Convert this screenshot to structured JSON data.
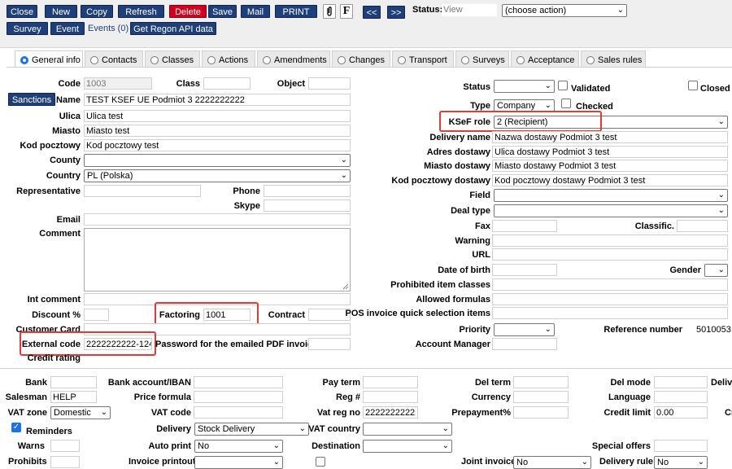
{
  "toolbar": {
    "row1": [
      "Close",
      "New",
      "Copy",
      "Refresh",
      "Delete",
      "Save",
      "Mail",
      "PRINT"
    ],
    "clip_icon": "paperclip-icon",
    "font_btn": "F",
    "prev": "<<",
    "next": ">>",
    "status_label": "Status:",
    "status_value": "View",
    "action_select": "(choose action)",
    "row2": [
      "Survey",
      "Event"
    ],
    "events_link": "Events (0)",
    "regon": "Get Regon API data"
  },
  "tabs": [
    "General info",
    "Contacts",
    "Classes",
    "Actions",
    "Amendments",
    "Changes",
    "Transport",
    "Surveys",
    "Acceptance",
    "Sales rules"
  ],
  "left": {
    "code_label": "Code",
    "code_value": "1003",
    "class_label": "Class",
    "object_label": "Object",
    "sanctions": "Sanctions",
    "name_label": "Name",
    "name_value": "TEST KSEF UE Podmiot 3 2222222222",
    "ulica_label": "Ulica",
    "ulica_value": "Ulica test",
    "miasto_label": "Miasto",
    "miasto_value": "Miasto test",
    "kod_label": "Kod pocztowy",
    "kod_value": "Kod pocztowy test",
    "county_label": "County",
    "country_label": "Country",
    "country_value": "PL (Polska)",
    "rep_label": "Representative",
    "phone_label": "Phone",
    "skype_label": "Skype",
    "email_label": "Email",
    "comment_label": "Comment",
    "intcomment_label": "Int comment",
    "discount_label": "Discount %",
    "factoring_label": "Factoring",
    "factoring_value": "1001",
    "contract_label": "Contract",
    "customercard_label": "Customer Card",
    "extcode_label": "External code",
    "extcode_value": "2222222222-124",
    "password_label": "Password for the emailed PDF invoice",
    "credit_label": "Credit rating"
  },
  "right": {
    "status_label": "Status",
    "validated_label": "Validated",
    "closed_label": "Closed",
    "type_label": "Type",
    "type_value": "Company",
    "checked_label": "Checked",
    "ksef_label": "KSeF role",
    "ksef_value": "2 (Recipient)",
    "delname_label": "Delivery name",
    "delname_value": "Nazwa dostawy Podmiot 3 test",
    "adres_label": "Adres dostawy",
    "adres_value": "Ulica dostawy Podmiot 3 test",
    "miastod_label": "Miasto dostawy",
    "miastod_value": "Miasto dostawy Podmiot 3 test",
    "kodd_label": "Kod pocztowy dostawy",
    "kodd_value": "Kod pocztowy dostawy Podmiot 3 test",
    "field_label": "Field",
    "dealtype_label": "Deal type",
    "fax_label": "Fax",
    "classific_label": "Classific.",
    "warning_label": "Warning",
    "url_label": "URL",
    "dob_label": "Date of birth",
    "gender_label": "Gender",
    "prohib_label": "Prohibited item classes",
    "allowed_label": "Allowed formulas",
    "pos_label": "POS invoice quick selection items",
    "priority_label": "Priority",
    "refnum_label": "Reference number",
    "refnum_value": "5010053",
    "accmgr_label": "Account Manager"
  },
  "bottom": {
    "bank_label": "Bank",
    "iban_label": "Bank account/IBAN",
    "payterm_label": "Pay term",
    "delterm_label": "Del term",
    "delmode_label": "Del mode",
    "deliv_cut": "Deliv",
    "salesman_label": "Salesman",
    "salesman_value": "HELP",
    "priceformula_label": "Price formula",
    "reg_label": "Reg #",
    "currency_label": "Currency",
    "language_label": "Language",
    "vatzone_label": "VAT zone",
    "vatzone_value": "Domestic",
    "vatcode_label": "VAT code",
    "vatreg_label": "Vat reg no",
    "vatreg_value": "2222222222",
    "prepay_label": "Prepayment%",
    "creditlimit_label": "Credit limit",
    "creditlimit_value": "0.00",
    "cr_cut": "Cr",
    "reminders_label": "Reminders",
    "delivery_label": "Delivery",
    "delivery_value": "Stock Delivery",
    "vatcountry_label": "VAT country",
    "warns_label": "Warns",
    "autoprint_label": "Auto print",
    "autoprint_value": "No",
    "destination_label": "Destination",
    "special_label": "Special offers",
    "prohibits_cut": "Prohibits",
    "invprint_cut": "Invoice printout",
    "joint_cut": "Joint invoice",
    "joint_value": "No",
    "delrule_cut": "Delivery rule",
    "delrule_value": "No"
  }
}
